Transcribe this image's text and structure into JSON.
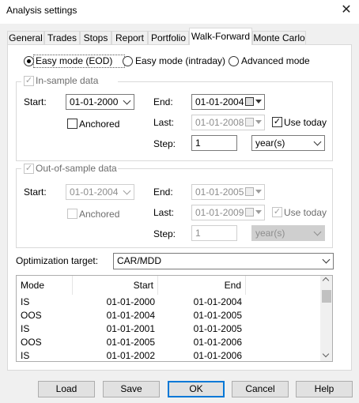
{
  "window": {
    "title": "Analysis settings",
    "close_label": "✕"
  },
  "tabs": [
    {
      "label": "General"
    },
    {
      "label": "Trades"
    },
    {
      "label": "Stops"
    },
    {
      "label": "Report"
    },
    {
      "label": "Portfolio"
    },
    {
      "label": "Walk-Forward"
    },
    {
      "label": "Monte Carlo"
    }
  ],
  "active_tab": "Walk-Forward",
  "mode": {
    "easy_eod": "Easy mode (EOD)",
    "easy_intraday": "Easy mode (intraday)",
    "advanced": "Advanced mode",
    "selected": "easy_eod"
  },
  "in_sample": {
    "label": "In-sample data",
    "start_label": "Start:",
    "start_value": "01-01-2000",
    "anchored_label": "Anchored",
    "end_label": "End:",
    "end_value": "01-01-2004",
    "last_label": "Last:",
    "last_value": "01-01-2008",
    "use_today_label": "Use today",
    "step_label": "Step:",
    "step_value": "1",
    "step_unit": "year(s)"
  },
  "out_of_sample": {
    "label": "Out-of-sample data",
    "start_label": "Start:",
    "start_value": "01-01-2004",
    "anchored_label": "Anchored",
    "end_label": "End:",
    "end_value": "01-01-2005",
    "last_label": "Last:",
    "last_value": "01-01-2009",
    "use_today_label": "Use today",
    "step_label": "Step:",
    "step_value": "1",
    "step_unit": "year(s)"
  },
  "optimization": {
    "label": "Optimization target:",
    "value": "CAR/MDD"
  },
  "table": {
    "headers": [
      "Mode",
      "Start",
      "End"
    ],
    "rows": [
      [
        "IS",
        "01-01-2000",
        "01-01-2004"
      ],
      [
        "OOS",
        "01-01-2004",
        "01-01-2005"
      ],
      [
        "IS",
        "01-01-2001",
        "01-01-2005"
      ],
      [
        "OOS",
        "01-01-2005",
        "01-01-2006"
      ],
      [
        "IS",
        "01-01-2002",
        "01-01-2006"
      ]
    ]
  },
  "buttons": {
    "load": "Load",
    "save": "Save",
    "ok": "OK",
    "cancel": "Cancel",
    "help": "Help"
  },
  "colors": {
    "accent": "#0078d7",
    "panel": "#ffffff",
    "dialog": "#f0f0f0"
  },
  "icons": {
    "calendar": "calendar-icon",
    "dropdown": "chevron-down-icon",
    "check": "check-icon"
  }
}
